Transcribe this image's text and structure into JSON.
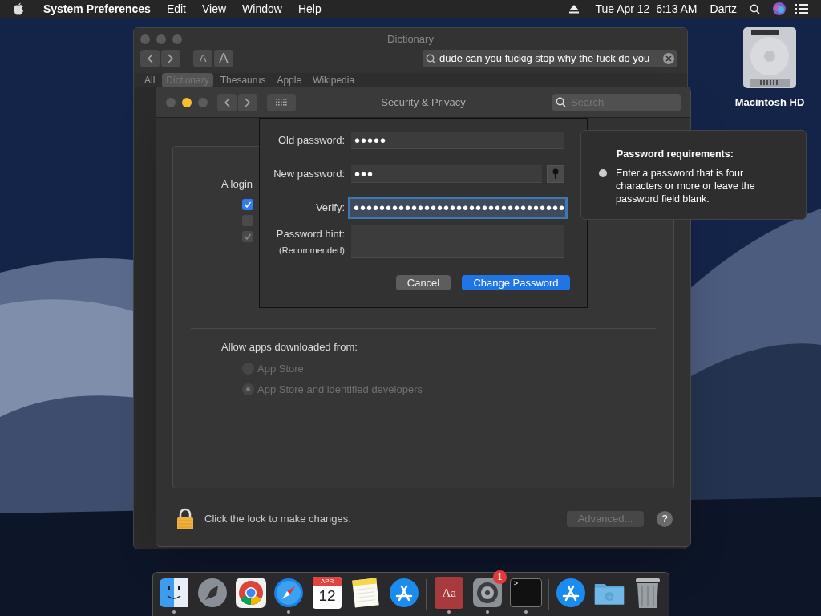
{
  "menu_bar": {
    "app": "System Preferences",
    "menus": [
      "Edit",
      "View",
      "Window",
      "Help"
    ],
    "clock": "Tue Apr 12  6:13 AM",
    "user": "Dartz"
  },
  "desktop_icons": [
    {
      "label": "Macintosh HD"
    }
  ],
  "dictionary_window": {
    "title": "Dictionary",
    "font_buttons": [
      "A",
      "A"
    ],
    "search_value": "dude can you fuckig stop why the fuck do you",
    "tabs": [
      {
        "label": "All",
        "selected": false
      },
      {
        "label": "Dictionary",
        "selected": true
      },
      {
        "label": "Thesaurus",
        "selected": false
      },
      {
        "label": "Apple",
        "selected": false
      },
      {
        "label": "Wikipedia",
        "selected": false
      }
    ]
  },
  "security_window": {
    "title": "Security & Privacy",
    "search_placeholder": "Search",
    "login_text": "A login",
    "checkboxes": [
      {
        "checked": true,
        "disabled": false
      },
      {
        "checked": false,
        "disabled": true
      },
      {
        "checked": true,
        "disabled": true
      }
    ],
    "allow_label": "Allow apps downloaded from:",
    "radios": [
      {
        "label": "App Store",
        "selected": false
      },
      {
        "label": "App Store and identified developers",
        "selected": true
      }
    ],
    "lock_text": "Click the lock to make changes.",
    "advanced_button": "Advanced...",
    "help_button": "?"
  },
  "password_sheet": {
    "fields": [
      {
        "label": "Old password:",
        "value": "•••••",
        "focused": false
      },
      {
        "label": "New password:",
        "value": "•••",
        "focused": false
      },
      {
        "label": "Verify:",
        "value": "•••••••••••••••••••••••••••••••••",
        "focused": true
      }
    ],
    "hint_label": "Password hint:",
    "hint_sublabel": "(Recommended)",
    "cancel": "Cancel",
    "submit": "Change Password"
  },
  "popover": {
    "title": "Password requirements:",
    "items": [
      "Enter a password that is four characters or more or leave the password field blank."
    ]
  },
  "dock": [
    {
      "kind": "finder",
      "running": true
    },
    {
      "kind": "launchpad",
      "running": false
    },
    {
      "kind": "chrome",
      "running": false
    },
    {
      "kind": "safari",
      "running": true
    },
    {
      "kind": "calendar",
      "running": false,
      "month": "APR",
      "day": "12"
    },
    {
      "kind": "notes",
      "running": false
    },
    {
      "kind": "appstore",
      "running": false
    },
    {
      "kind": "separator"
    },
    {
      "kind": "dictionary",
      "running": true,
      "text": "Aa"
    },
    {
      "kind": "preferences",
      "running": true,
      "badge": "1"
    },
    {
      "kind": "terminal",
      "running": true,
      "text": ">_"
    },
    {
      "kind": "separator"
    },
    {
      "kind": "appstore",
      "running": false
    },
    {
      "kind": "folder",
      "running": false
    },
    {
      "kind": "trash",
      "running": false
    }
  ]
}
